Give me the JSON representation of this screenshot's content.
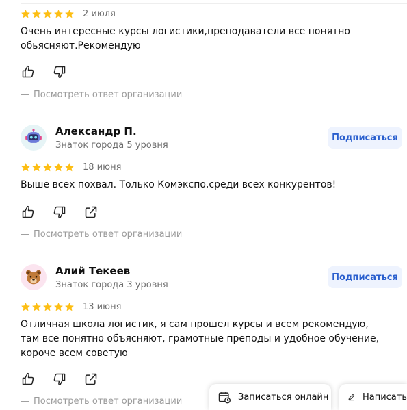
{
  "review1": {
    "date": "2 июля",
    "text": "Очень интересные курсы логистики,преподаватели все понятно обьясняют.Рекомендую",
    "reply_link": "Посмотреть ответ организации"
  },
  "review2": {
    "name": "Александр П.",
    "level": "Знаток города 5 уровня",
    "subscribe": "Подписаться",
    "date": "18 июня",
    "text": "Выше всех похвал. Только Комэкспо,среди всех конкурентов!",
    "reply_link": "Посмотреть ответ организации",
    "avatar_bg": "#e6f4f6"
  },
  "review3": {
    "name": "Алий Текеев",
    "level": "Знаток города 3 уровня",
    "subscribe": "Подписаться",
    "date": "13 июня",
    "text": "Отличная школа логистик, я сам прошел курсы и всем рекомендую, там все понятно объясняют, грамотные преподы и удобное обучение, короче всем советую",
    "reply_link": "Посмотреть ответ организации",
    "avatar_bg": "#fbe4ef"
  },
  "common": {
    "dash": "—",
    "star_color": "#fdbe13",
    "subscribe_bg": "#eef3fe",
    "subscribe_color": "#2a5fce"
  },
  "floating": {
    "book_label": "Записаться онлайн",
    "write_label": "Написать"
  },
  "icons": [
    "star-icon",
    "thumbs-up-icon",
    "thumbs-down-icon",
    "share-icon",
    "robot-avatar-icon",
    "bear-avatar-icon",
    "calendar-icon",
    "pencil-icon"
  ]
}
